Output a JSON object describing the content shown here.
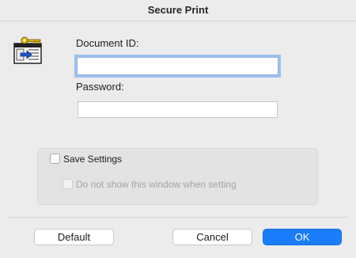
{
  "dialog": {
    "title": "Secure Print"
  },
  "icon": {
    "name": "secure-print-key-document-icon"
  },
  "fields": {
    "document_id_label": "Document ID:",
    "document_id_value": "",
    "password_label": "Password:",
    "password_value": ""
  },
  "options": {
    "save_settings_label": "Save Settings",
    "save_settings_checked": false,
    "dont_show_label": "Do not show this window when setting",
    "dont_show_checked": false,
    "dont_show_enabled": false
  },
  "buttons": {
    "default_label": "Default",
    "cancel_label": "Cancel",
    "ok_label": "OK"
  },
  "colors": {
    "accent": "#1a7dfa",
    "focus_ring": "#9cc0ee",
    "background": "#ececec"
  }
}
